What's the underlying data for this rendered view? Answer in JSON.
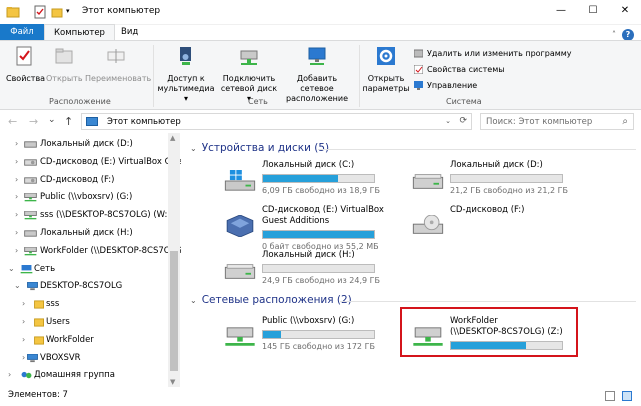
{
  "window": {
    "title": "Этот компьютер",
    "minimize": "—",
    "maximize": "☐",
    "close": "✕",
    "help": "?",
    "ribbon_toggle": "˄"
  },
  "tabs": {
    "file": "Файл",
    "computer": "Компьютер",
    "view": "Вид"
  },
  "ribbon": {
    "location": {
      "label": "Расположение",
      "properties": "Свойства",
      "open": "Открыть",
      "rename": "Переименовать"
    },
    "network": {
      "label": "Сеть",
      "media_line1": "Доступ к",
      "media_line2": "мультимедиа ▾",
      "map_line1": "Подключить",
      "map_line2": "сетевой диск ▾",
      "add_line1": "Добавить сетевое",
      "add_line2": "расположение"
    },
    "system": {
      "label": "Система",
      "open_line1": "Открыть",
      "open_line2": "параметры",
      "uninstall": "Удалить или изменить программу",
      "properties": "Свойства системы",
      "manage": "Управление"
    }
  },
  "nav": {
    "back": "←",
    "forward": "→",
    "recent": "⌄",
    "up": "↑",
    "address": "Этот компьютер",
    "address_dropdown": "⌄",
    "refresh": "⟳",
    "search_placeholder": "Поиск: Этот компьютер",
    "search_icon": "⌕"
  },
  "sidebar": {
    "items": [
      {
        "label": "Локальный диск (D:)",
        "arrow": "›",
        "icon": "hdd-icon"
      },
      {
        "label": "CD-дисковод (E:) VirtualBox Gue",
        "arrow": "›",
        "icon": "cd-icon"
      },
      {
        "label": "CD-дисковод (F:)",
        "arrow": "›",
        "icon": "cd-icon"
      },
      {
        "label": "Public (\\\\vboxsrv) (G:)",
        "arrow": "›",
        "icon": "network-drive-icon"
      },
      {
        "label": "sss (\\\\DESKTOP-8CS7OLG) (W:)",
        "arrow": "›",
        "icon": "network-drive-icon"
      },
      {
        "label": "Локальный диск (H:)",
        "arrow": "›",
        "icon": "hdd-icon"
      },
      {
        "label": "WorkFolder (\\\\DESKTOP-8CS7OLG",
        "arrow": "›",
        "icon": "network-drive-icon"
      },
      {
        "label": "Сеть",
        "arrow": "⌄",
        "icon": "network-icon"
      },
      {
        "label": "DESKTOP-8CS7OLG",
        "arrow": "⌄",
        "icon": "computer-icon"
      },
      {
        "label": "sss",
        "arrow": "›",
        "icon": "folder-icon"
      },
      {
        "label": "Users",
        "arrow": "›",
        "icon": "folder-icon"
      },
      {
        "label": "WorkFolder",
        "arrow": "›",
        "icon": "folder-icon"
      },
      {
        "label": "VBOXSVR",
        "arrow": "›",
        "icon": "computer-icon"
      },
      {
        "label": "Домашняя группа",
        "arrow": "›",
        "icon": "homegroup-icon"
      }
    ]
  },
  "content": {
    "devices_header": "Устройства и диски (5)",
    "network_header": "Сетевые расположения (2)",
    "drives": [
      {
        "name": "Локальный диск (C:)",
        "free": "6,09 ГБ свободно из 18,9 ГБ",
        "used": 0.68,
        "kind": "windows"
      },
      {
        "name": "Локальный диск (D:)",
        "free": "21,2 ГБ свободно из 21,2 ГБ",
        "used": 0.0,
        "kind": "hdd"
      },
      {
        "name": "CD-дисковод (E:) VirtualBox",
        "name2": "Guest Additions",
        "free": "0 байт свободно из 55,2 МБ",
        "used": 1.0,
        "kind": "vbox"
      },
      {
        "name": "CD-дисковод (F:)",
        "kind": "cd"
      },
      {
        "name": "Локальный диск (H:)",
        "free": "24,9 ГБ свободно из 24,9 ГБ",
        "used": 0.0,
        "kind": "hdd"
      },
      {
        "name": "Public (\\\\vboxsrv) (G:)",
        "free": "145 ГБ свободно из 172 ГБ",
        "used": 0.16,
        "kind": "net"
      },
      {
        "name": "WorkFolder",
        "name2": "(\\\\DESKTOP-8CS7OLG) (Z:)",
        "used": 0.68,
        "kind": "net"
      }
    ]
  },
  "status": {
    "items": "Элементов: 7"
  }
}
